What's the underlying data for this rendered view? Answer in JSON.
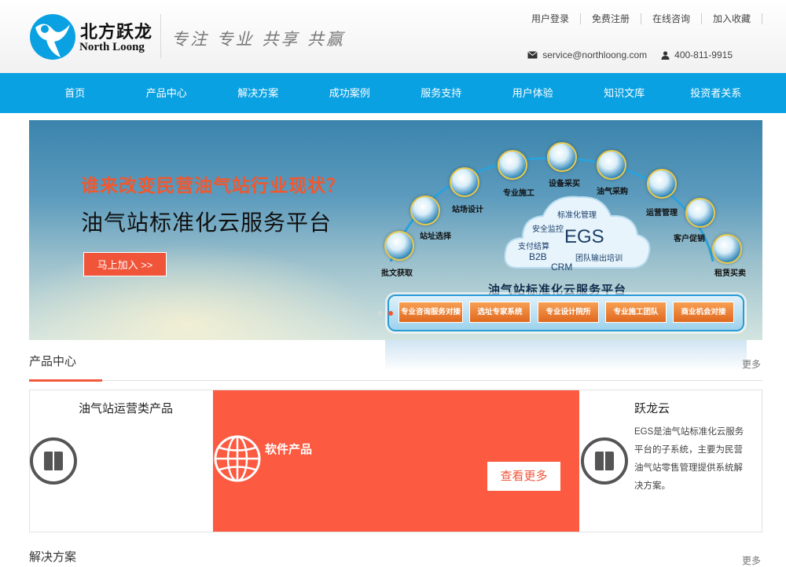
{
  "brand": {
    "name_cn": "北方跃龙",
    "name_en": "North Loong",
    "slogan": "专注 专业 共享 共赢"
  },
  "top_links": [
    "用户登录",
    "免费注册",
    "在线咨询",
    "加入收藏"
  ],
  "contact": {
    "email": "service@northloong.com",
    "phone": "400-811-9915"
  },
  "nav": [
    "首页",
    "产品中心",
    "解决方案",
    "成功案例",
    "服务支持",
    "用户体验",
    "知识文库",
    "投资者关系"
  ],
  "banner": {
    "question": "谁来改变民营油气站行业现状？",
    "title": "油气站标准化云服务平台",
    "cta": "马上加入 >>",
    "nodes": [
      "批文获取",
      "站址选择",
      "站场设计",
      "专业施工",
      "设备采买",
      "油气采购",
      "运营管理",
      "客户促销",
      "租赁买卖"
    ],
    "cloud": {
      "egs": "EGS",
      "items": [
        "标准化管理",
        "安全监控",
        "支付结算",
        "团队输出培训",
        "B2B",
        "CRM"
      ]
    },
    "platform_label": "油气站标准化云服务平台",
    "platform_buttons": [
      "专业咨询服务对接",
      "选址专家系统",
      "专业设计院所",
      "专业施工团队",
      "商业机会对接"
    ]
  },
  "products": {
    "title": "产品中心",
    "more": "更多",
    "left_title": "油气站运营类产品",
    "mid_title": "软件产品",
    "mid_button": "查看更多",
    "right_title": "跃龙云",
    "right_desc": "EGS是油气站标准化云服务平台的子系统，主要为民营油气站零售管理提供系统解决方案。"
  },
  "solutions": {
    "title": "解决方案",
    "more": "更多"
  },
  "colors": {
    "nav": "#0aa1e2",
    "accent": "#ee5a3b",
    "card": "#fc5a41"
  }
}
